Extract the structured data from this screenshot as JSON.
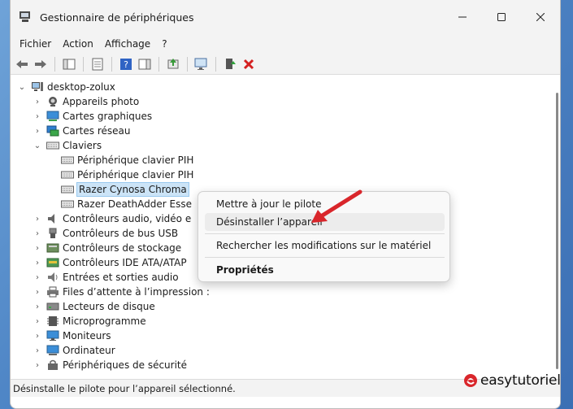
{
  "window": {
    "title": "Gestionnaire de périphériques"
  },
  "menu": [
    "Fichier",
    "Action",
    "Affichage",
    "?"
  ],
  "tree": {
    "root": "desktop-zolux",
    "categories": [
      {
        "label": "Appareils photo",
        "icon": "camera-icon"
      },
      {
        "label": "Cartes graphiques",
        "icon": "display-adapter-icon"
      },
      {
        "label": "Cartes réseau",
        "icon": "network-adapter-icon"
      },
      {
        "label": "Claviers",
        "icon": "keyboard-icon",
        "expanded": true
      },
      {
        "label": "Contrôleurs audio, vidéo e",
        "icon": "audio-icon"
      },
      {
        "label": "Contrôleurs de bus USB",
        "icon": "usb-icon"
      },
      {
        "label": "Contrôleurs de stockage",
        "icon": "storage-icon"
      },
      {
        "label": "Contrôleurs IDE ATA/ATAP",
        "icon": "ide-icon"
      },
      {
        "label": "Entrées et sorties audio",
        "icon": "speaker-icon"
      },
      {
        "label": "Files d’attente à l’impression :",
        "icon": "printer-icon"
      },
      {
        "label": "Lecteurs de disque",
        "icon": "disk-icon"
      },
      {
        "label": "Microprogramme",
        "icon": "firmware-icon"
      },
      {
        "label": "Moniteurs",
        "icon": "monitor-icon"
      },
      {
        "label": "Ordinateur",
        "icon": "computer-icon"
      },
      {
        "label": "Périphériques de sécurité",
        "icon": "security-icon"
      }
    ],
    "keyboards": [
      "Périphérique clavier PIH",
      "Périphérique clavier PIH",
      "Razer Cynosa Chroma",
      "Razer DeathAdder Esse"
    ],
    "selected": "Razer Cynosa Chroma"
  },
  "context_menu": {
    "items": [
      "Mettre à jour le pilote",
      "Désinstaller l’appareil",
      "Rechercher les modifications sur le matériel",
      "Propriétés"
    ]
  },
  "status": {
    "text": "Désinstalle le pilote pour l’appareil sélectionné."
  },
  "watermark": {
    "text": "easytutoriel"
  },
  "colors": {
    "accent_arrow": "#d9262b",
    "selection": "#cce4f7"
  }
}
